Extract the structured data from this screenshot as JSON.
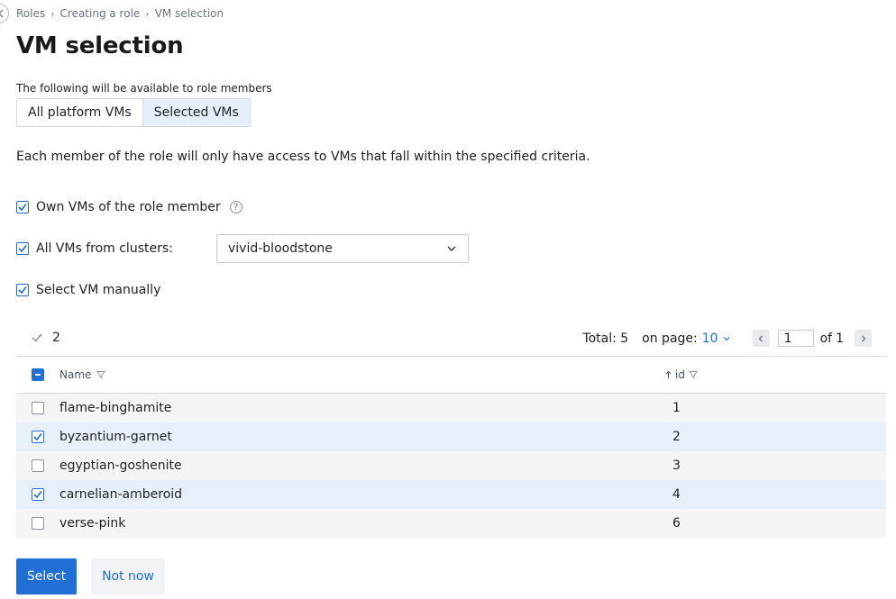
{
  "breadcrumb": [
    "Roles",
    "Creating a role",
    "VM selection"
  ],
  "page_title": "VM selection",
  "scope": {
    "label": "The following will be available to role members",
    "options": [
      "All platform VMs",
      "Selected VMs"
    ],
    "selected": "Selected VMs"
  },
  "description": "Each member of the role will only have access to VMs that fall within the specified criteria.",
  "criteria": {
    "own_vms": {
      "label": "Own VMs of the role member",
      "checked": true,
      "help": "?"
    },
    "clusters": {
      "label": "All VMs from clusters:",
      "checked": true,
      "value": "vivid-bloodstone"
    },
    "manual": {
      "label": "Select VM manually",
      "checked": true
    }
  },
  "toolbar": {
    "selected_count": "2",
    "total_label": "Total: 5",
    "per_page_label": "on page:",
    "per_page_value": "10",
    "current_page": "1",
    "of_label": "of",
    "total_pages": "1"
  },
  "table": {
    "columns": {
      "name": "Name",
      "id": "id"
    },
    "rows": [
      {
        "name": "flame-binghamite",
        "id": "1",
        "checked": false
      },
      {
        "name": "byzantium-garnet",
        "id": "2",
        "checked": true
      },
      {
        "name": "egyptian-goshenite",
        "id": "3",
        "checked": false
      },
      {
        "name": "carnelian-amberoid",
        "id": "4",
        "checked": true
      },
      {
        "name": "verse-pink",
        "id": "6",
        "checked": false
      }
    ]
  },
  "actions": {
    "primary": "Select",
    "secondary": "Not now"
  },
  "colors": {
    "accent": "#1f6fd4",
    "selected_row": "#e8f0fb",
    "row": "#f5f5f6"
  }
}
